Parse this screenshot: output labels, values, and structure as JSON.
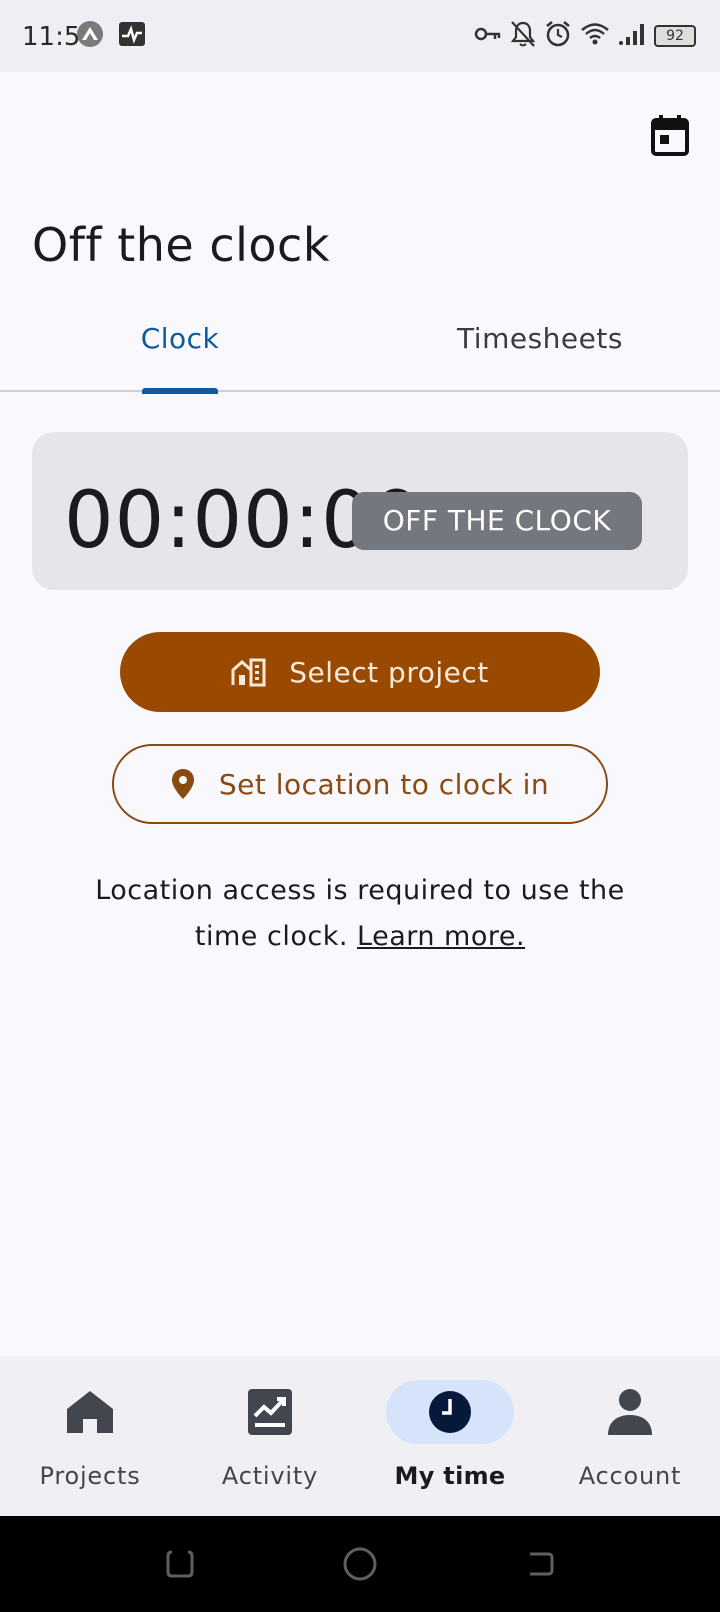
{
  "status_bar": {
    "time": "11:51",
    "battery": "92"
  },
  "header": {
    "title": "Off the clock"
  },
  "tabs": [
    {
      "label": "Clock",
      "active": true
    },
    {
      "label": "Timesheets",
      "active": false
    }
  ],
  "timer": {
    "value": "00:00:00",
    "status_badge": "OFF THE CLOCK"
  },
  "actions": {
    "select_project": "Select project",
    "set_location": "Set location to clock in"
  },
  "info": {
    "text": "Location access is required to use the time clock.",
    "link": "Learn more."
  },
  "bottom_nav": [
    {
      "label": "Projects",
      "icon": "home-icon",
      "active": false
    },
    {
      "label": "Activity",
      "icon": "activity-chart-icon",
      "active": false
    },
    {
      "label": "My time",
      "icon": "clock-icon",
      "active": true
    },
    {
      "label": "Account",
      "icon": "person-icon",
      "active": false
    }
  ],
  "colors": {
    "brand": "#9a4a00",
    "accent": "#0e5a9c",
    "active_nav_pill": "#d5e3fb"
  }
}
